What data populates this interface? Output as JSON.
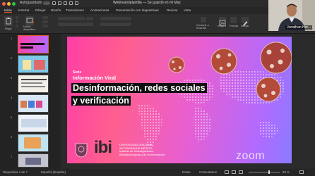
{
  "titlebar": {
    "autosave_label": "Autoguardado",
    "window_title": "WebinarioIplantilla — Se guardó en mi Mac"
  },
  "tabs": [
    "Inicio",
    "Insertar",
    "Dibujar",
    "Diseño",
    "Transiciones",
    "Animaciones",
    "Presentación con diapositivas",
    "Revisar",
    "Vista"
  ],
  "ribbon": {
    "paste_label": "Pegar",
    "new_slide_label": "Nueva diapositiva",
    "convert_label": "Convertir a SmartArt",
    "image_label": "Imagen",
    "shapes_label": "Formas",
    "arrange_label": "Organizar",
    "draw_label": "Dibujar"
  },
  "thumbnails": [
    "1",
    "2",
    "3",
    "4",
    "5",
    "6",
    "7"
  ],
  "slide": {
    "series_label": "Serie",
    "series_name": "Información Viral",
    "title_line1": "Desinformación, redes sociales",
    "title_line2": "y verificación",
    "org_line1": "UNIVERSIDAD NACIONAL",
    "org_line2": "AUTÓNOMA DE MÉXICO",
    "org_line3": "Instituto de Investigaciones",
    "org_line4": "Bibliotecológicas y de la Información",
    "logo_text": "ibi"
  },
  "camera": {
    "participant_name": "Jonathan Her..."
  },
  "watermark": "zoom",
  "statusbar": {
    "slide_info": "Diapositiva 1 de 7",
    "language": "Español (España)",
    "notes_label": "Notas",
    "comments_label": "Comentarios",
    "zoom_level": "95 %"
  },
  "colors": {
    "accent": "#e05a2b",
    "slide_gradient_start": "#ff3ea5",
    "slide_gradient_end": "#8a7bff"
  }
}
